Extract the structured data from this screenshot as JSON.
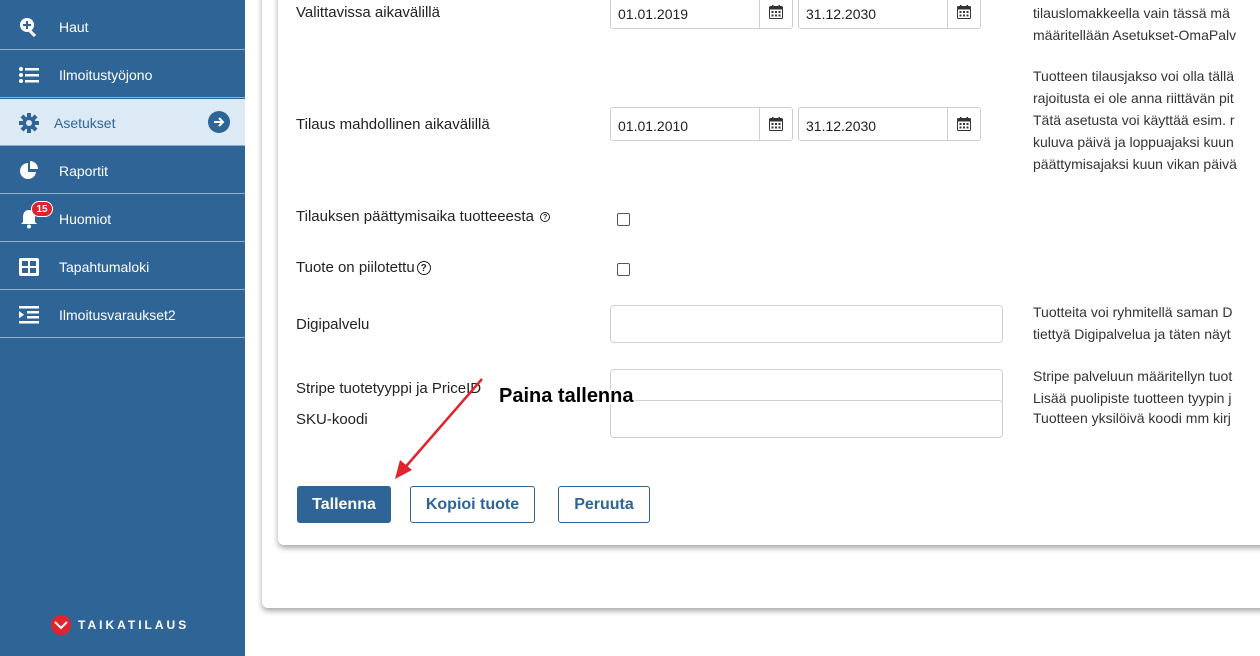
{
  "sidebar": {
    "items": [
      {
        "label": "Haut",
        "icon": "search-plus-icon"
      },
      {
        "label": "Ilmoitustyöjono",
        "icon": "list-icon"
      },
      {
        "label": "Asetukset",
        "icon": "gear-icon",
        "active": true
      },
      {
        "label": "Raportit",
        "icon": "pie-chart-icon"
      },
      {
        "label": "Huomiot",
        "icon": "bell-icon",
        "badge": "15"
      },
      {
        "label": "Tapahtumaloki",
        "icon": "table-icon"
      },
      {
        "label": "Ilmoitusvaraukset2",
        "icon": "indent-list-icon"
      }
    ],
    "logo_text": "TAIKATILAUS"
  },
  "form": {
    "valittavissa": {
      "label": "Valittavissa aikavälillä",
      "start": "01.01.2019",
      "end": "31.12.2030",
      "desc": [
        "tilauslomakkeella vain tässä mä",
        "määritellään Asetukset-OmaPalv"
      ]
    },
    "tilaus_mahdollinen": {
      "label": "Tilaus mahdollinen aikavälillä",
      "start": "01.01.2010",
      "end": "31.12.2030",
      "desc": [
        "Tuotteen tilausjakso voi olla tällä",
        "rajoitusta ei ole anna riittävän pit",
        "Tätä asetusta voi käyttää esim. r",
        "kuluva päivä ja loppuajaksi kuun",
        "päättymisajaksi kuun vikan päivä"
      ]
    },
    "paattymisaika": {
      "label": "Tilauksen päättymisaika tuotteeesta",
      "help": "?"
    },
    "piilotettu": {
      "label": "Tuote on piilotettu",
      "help": "?"
    },
    "digipalvelu": {
      "label": "Digipalvelu",
      "value": "",
      "desc": [
        "Tuotteita voi ryhmitellä saman D",
        "tiettyä Digipalvelua ja täten näyt"
      ]
    },
    "stripe": {
      "label": "Stripe tuotetyyppi ja PriceID",
      "value": "",
      "desc": [
        "Stripe palveluun määritellyn tuot",
        "Lisää puolipiste tuotteen tyypin j"
      ]
    },
    "sku": {
      "label": "SKU-koodi",
      "value": "",
      "desc": [
        "Tuotteen yksilöivä koodi mm kirj"
      ]
    }
  },
  "buttons": {
    "save": "Tallenna",
    "copy": "Kopioi tuote",
    "cancel": "Peruuta"
  },
  "annotation": {
    "text": "Paina tallenna",
    "color": "#e0232c"
  },
  "colors": {
    "sidebar": "#2f6596",
    "active_item_bg": "#dceaf6",
    "accent": "#2f6596",
    "badge": "#e0232c"
  }
}
